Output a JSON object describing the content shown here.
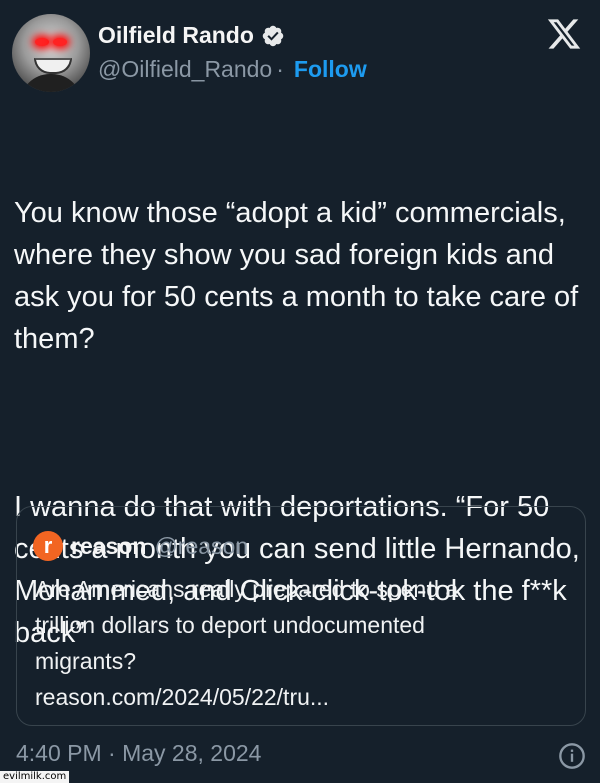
{
  "author": {
    "display_name": "Oilfield Rando",
    "handle": "@Oilfield_Rando",
    "separator": "·",
    "follow_label": "Follow",
    "verified_icon": "verified-badge-icon"
  },
  "platform_logo": "x-logo-icon",
  "tweet": {
    "paragraphs": [
      "You know those “adopt a kid” commercials, where they show you sad foreign kids and ask you for 50 cents a month to take care of them?",
      "I wanna do that with deportations. “For 50 cents a month you can send little Hernando, Mohammed, and Click-click-tok-tok the f**k back”"
    ]
  },
  "quote": {
    "avatar_letter": "r",
    "name": "reason",
    "handle": "@reason",
    "lines": [
      "Are Americans really prepared to spend a",
      "trillion dollars to deport undocumented",
      "migrants?",
      "reason.com/2024/05/22/tru..."
    ]
  },
  "timestamp": "4:40 PM · May 28, 2024",
  "watermark": "evilmilk.com",
  "colors": {
    "background": "#15202b",
    "accent": "#1d9bf0",
    "muted": "#8b98a5",
    "reason_brand": "#f26522"
  }
}
